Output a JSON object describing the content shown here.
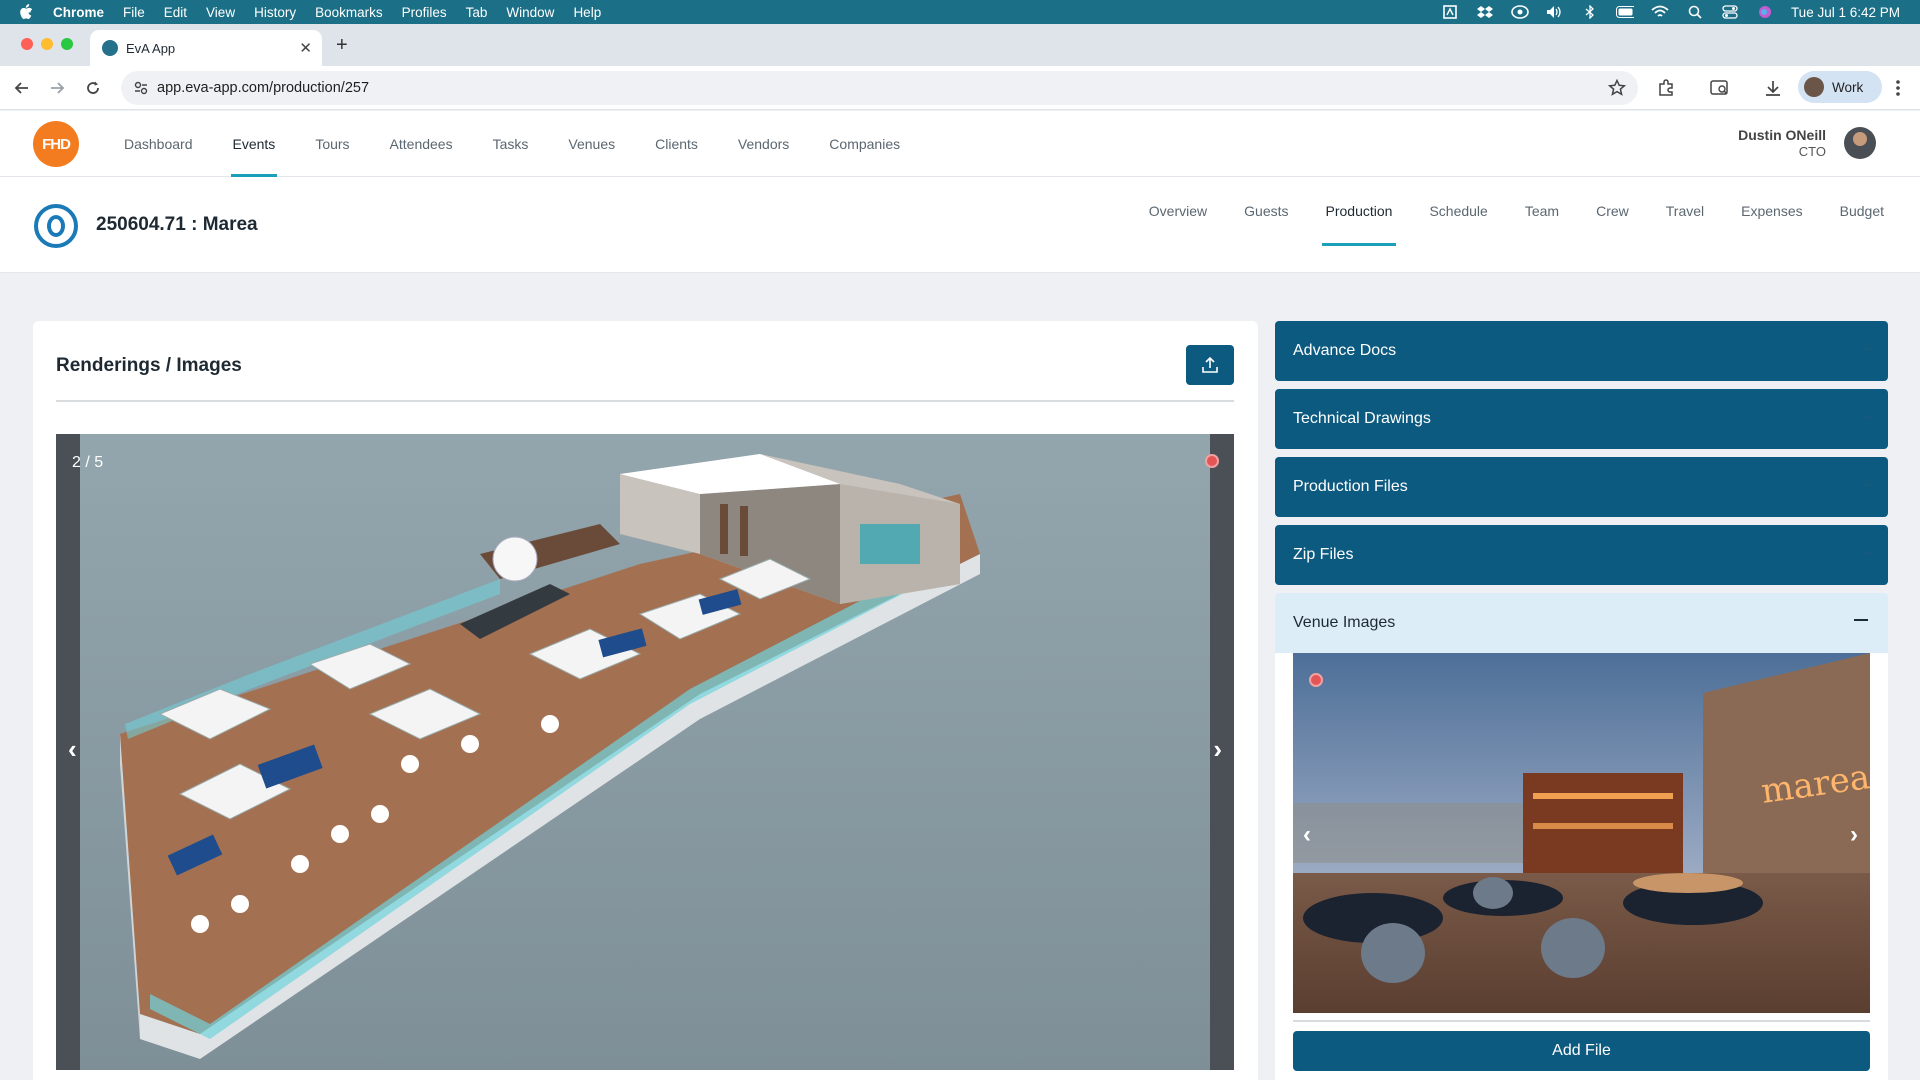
{
  "menubar": {
    "app": "Chrome",
    "items": [
      "File",
      "Edit",
      "View",
      "History",
      "Bookmarks",
      "Profiles",
      "Tab",
      "Window",
      "Help"
    ],
    "datetime": "Tue Jul 1  6:42 PM",
    "status_icons": [
      "adobe-icon",
      "dropbox-icon",
      "creative-cloud-icon",
      "volume-icon",
      "bluetooth-icon",
      "battery-icon",
      "wifi-icon",
      "spotlight-icon",
      "control-center-icon",
      "siri-icon"
    ]
  },
  "browser": {
    "tab_title": "EvA App",
    "url": "app.eva-app.com/production/257",
    "profile_label": "Work"
  },
  "app": {
    "logo_text": "FHD",
    "nav": [
      "Dashboard",
      "Events",
      "Tours",
      "Attendees",
      "Tasks",
      "Venues",
      "Clients",
      "Vendors",
      "Companies"
    ],
    "active_nav": "Events",
    "user": {
      "name": "Dustin ONeill",
      "role": "CTO"
    }
  },
  "event": {
    "title": "250604.71 : Marea",
    "tabs": [
      "Overview",
      "Guests",
      "Production",
      "Schedule",
      "Team",
      "Crew",
      "Travel",
      "Expenses",
      "Budget"
    ],
    "active_tab": "Production"
  },
  "renderings": {
    "title": "Renderings / Images",
    "counter": "2 / 5",
    "prev": "‹",
    "next": "›"
  },
  "sections": {
    "advance_docs": "Advance Docs",
    "technical_drawings": "Technical Drawings",
    "production_files": "Production Files",
    "zip_files": "Zip Files",
    "venue_images": "Venue Images",
    "expand_symbol": "+",
    "add_file": "Add File",
    "venue_sign_text": "marea"
  },
  "colors": {
    "menubar": "#1b6f86",
    "primary": "#0d5a80",
    "accent": "#1aa0b8",
    "logo_orange": "#f47c20",
    "open_section_bg": "#dcedf8"
  }
}
